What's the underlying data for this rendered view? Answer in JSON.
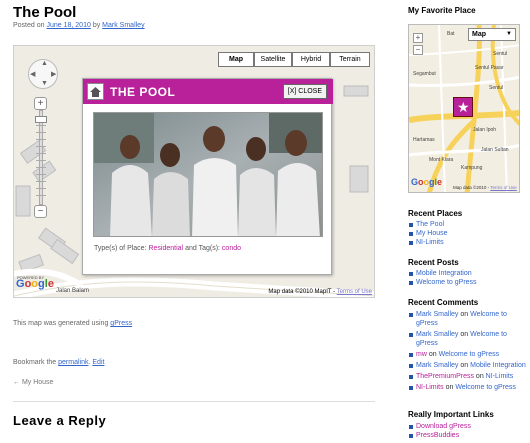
{
  "post": {
    "title": "The Pool",
    "posted_on": "Posted on",
    "date": "June 18, 2010",
    "by": "by",
    "author": "Mark Smalley"
  },
  "map": {
    "types": [
      {
        "label": "Map",
        "active": true
      },
      {
        "label": "Satellite",
        "active": false
      },
      {
        "label": "Hybrid",
        "active": false
      },
      {
        "label": "Terrain",
        "active": false
      }
    ],
    "zoom_in": "+",
    "zoom_out": "−",
    "powered_by": "POWERED BY",
    "logo": "Google",
    "road_label": "Jalan Balam",
    "attribution": "Map data ©2010 MapIT -",
    "terms": "Terms of Use",
    "info_window": {
      "title": "THE POOL",
      "close": "[X] CLOSE",
      "place_prefix": "Type(s) of Place:",
      "place_type": "Residential",
      "tags_prefix": "and Tag(s):",
      "tag": "condo",
      "header_color": "#b8219a",
      "icon": "home-icon"
    }
  },
  "footer": {
    "generated_prefix": "This map was generated using",
    "generated_link": "gPress",
    "bookmark_prefix": "Bookmark the",
    "permalink": "permalink",
    "edit": "Edit",
    "prev": "← My House",
    "leave_reply": "Leave a Reply"
  },
  "sidebar": {
    "favorite_place": {
      "heading": "My Favorite Place",
      "map_type": "Map",
      "logo": "Google",
      "attribution": "Map data ©2010 -",
      "terms": "Terms of Use",
      "labels": [
        "Bat",
        "Sentul",
        "Sentul Pasar",
        "Segambut",
        "Sentul",
        "Hartamas",
        "Jalan Ipoh",
        "Mont Kiara",
        "Jalan Sultan",
        "Kampung"
      ]
    },
    "recent_places": {
      "heading": "Recent Places",
      "items": [
        "The Pool",
        "My House",
        "NI-Limits"
      ]
    },
    "recent_posts": {
      "heading": "Recent Posts",
      "items": [
        "Mobile Integration",
        "Welcome to gPress"
      ]
    },
    "recent_comments": {
      "heading": "Recent Comments",
      "items": [
        {
          "author": "Mark Smalley",
          "on": "on",
          "post": "Welcome to gPress"
        },
        {
          "author": "Mark Smalley",
          "on": "on",
          "post": "Welcome to gPress"
        },
        {
          "author": "mw",
          "on": "on",
          "post": "Welcome to gPress"
        },
        {
          "author": "Mark Smalley",
          "on": "on",
          "post": "Mobile Integration"
        },
        {
          "author": "ThePremiumPress",
          "on": "on",
          "post": "NI-Limits"
        },
        {
          "author": "NI-Limits",
          "on": "on",
          "post": "Welcome to gPress"
        }
      ]
    },
    "important_links": {
      "heading": "Really Important Links",
      "items": [
        "Download gPress",
        "PressBuddies"
      ]
    }
  }
}
